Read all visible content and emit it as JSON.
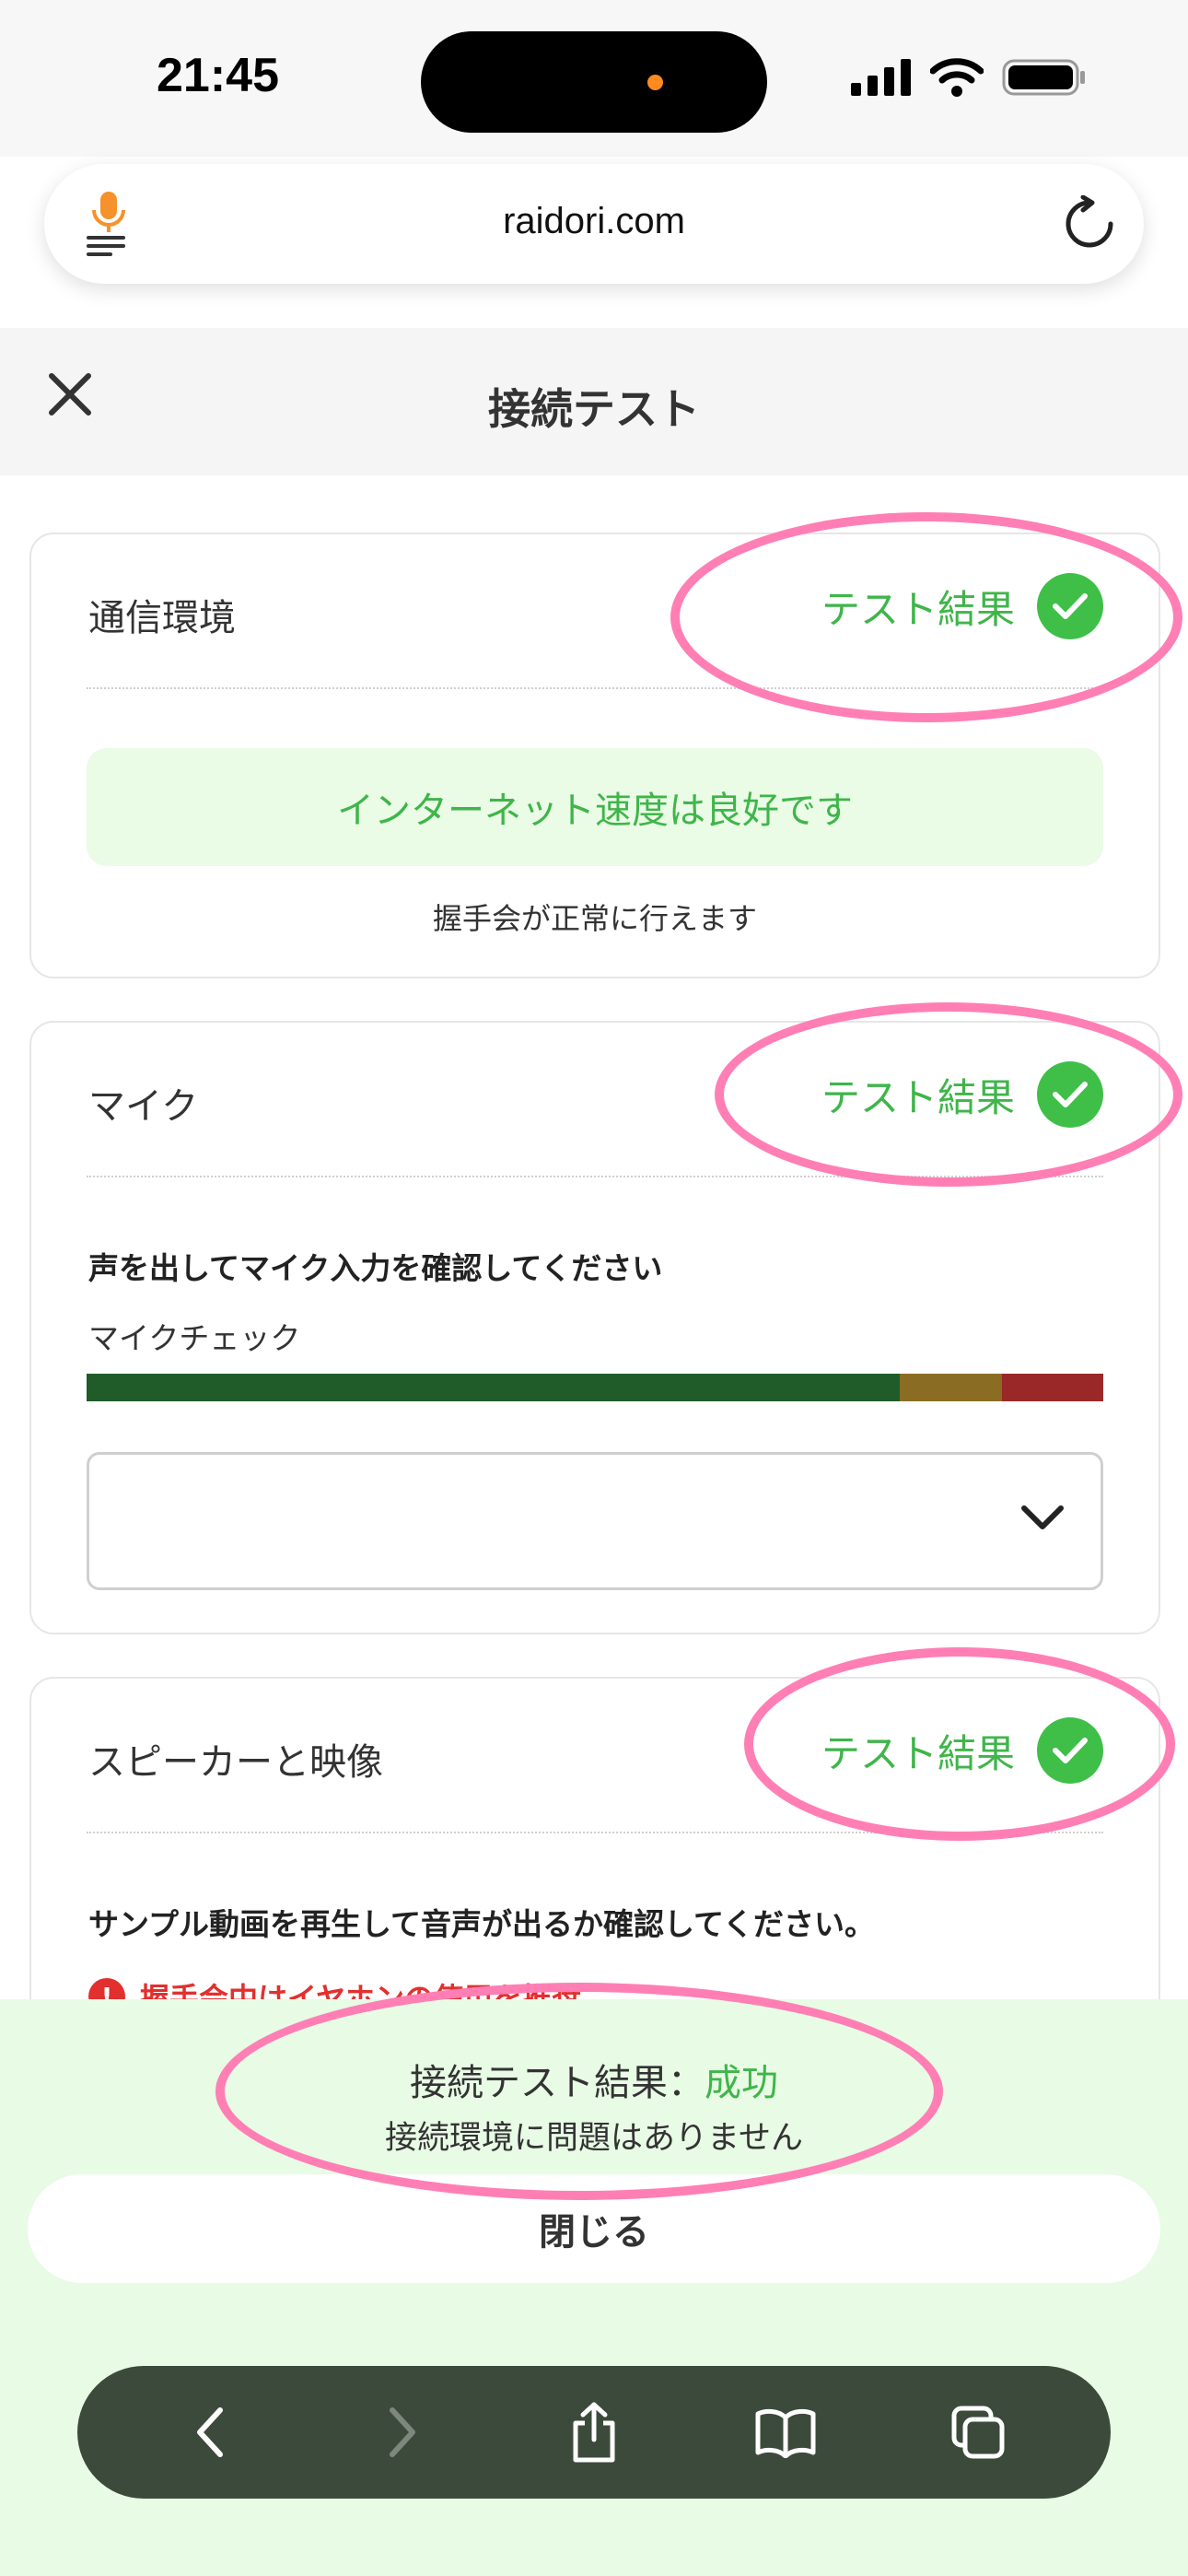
{
  "status_bar": {
    "time": "21:45"
  },
  "browser": {
    "address": "raidori.com",
    "icons": {
      "mic": "microphone-icon",
      "reload": "reload-icon"
    }
  },
  "modal": {
    "title": "接続テスト",
    "close_icon": "close-icon"
  },
  "cards": {
    "network": {
      "title": "通信環境",
      "result_label": "テスト結果",
      "speed_message": "インターネット速度は良好です",
      "speed_sub": "握手会が正常に行えます"
    },
    "mic": {
      "title": "マイク",
      "result_label": "テスト結果",
      "instruction": "声を出してマイク入力を確認してください",
      "check_label": "マイクチェック",
      "level": 1.0,
      "select_value": ""
    },
    "speaker": {
      "title": "スピーカーと映像",
      "result_label": "テスト結果",
      "instruction": "サンプル動画を再生して音声が出るか確認してください。",
      "warning": "握手会中はイヤホンの使用を推奨"
    }
  },
  "result": {
    "label": "接続テスト結果：",
    "value": "成功",
    "sub": "接続環境に問題はありません",
    "close_button": "閉じる"
  },
  "colors": {
    "success": "#3fb54a",
    "highlight": "#ff7fb4",
    "warning": "#e2302f"
  }
}
